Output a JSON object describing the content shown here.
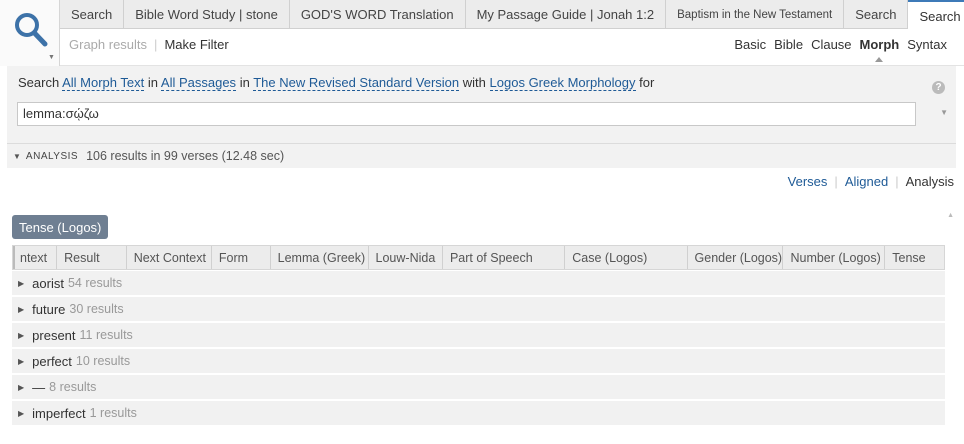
{
  "tabs": [
    {
      "label": "Search",
      "active": false,
      "small": false
    },
    {
      "label": "Bible Word Study | stone",
      "active": false,
      "small": false
    },
    {
      "label": "GOD'S WORD Translation",
      "active": false,
      "small": false
    },
    {
      "label": "My Passage Guide | Jonah 1:2",
      "active": false,
      "small": false
    },
    {
      "label": "Baptism in the New Testament",
      "active": false,
      "small": true
    },
    {
      "label": "Search",
      "active": false,
      "small": false
    },
    {
      "label": "Search",
      "active": true,
      "small": false
    }
  ],
  "tab_add_label": "+",
  "tab_close_label": "×",
  "toolbar": {
    "graph_results": "Graph results",
    "make_filter": "Make Filter",
    "modes": [
      "Basic",
      "Bible",
      "Clause",
      "Morph",
      "Syntax"
    ],
    "active_mode": "Morph"
  },
  "search": {
    "prefix": "Search",
    "scope": "All Morph Text",
    "in1": "in",
    "range": "All Passages",
    "in2": "in",
    "version": "The New Revised Standard Version",
    "with": "with",
    "morphology": "Logos Greek Morphology",
    "for": "for",
    "query": "lemma:σῴζω",
    "help": "?"
  },
  "results": {
    "section_label": "ANALYSIS",
    "summary": "106 results in 99 verses (12.48 sec)"
  },
  "view_links": {
    "verses": "Verses",
    "aligned": "Aligned",
    "analysis": "Analysis"
  },
  "group_by": "Tense (Logos)",
  "columns": [
    "ntext",
    "Result",
    "Next Context",
    "Form",
    "Lemma (Greek)",
    "Louw-Nida",
    "Part of Speech",
    "Case (Logos)",
    "Gender (Logos)",
    "Number (Logos)",
    "Tense"
  ],
  "groups": [
    {
      "name": "aorist",
      "count": "54 results"
    },
    {
      "name": "future",
      "count": "30 results"
    },
    {
      "name": "present",
      "count": "11 results"
    },
    {
      "name": "perfect",
      "count": "10 results"
    },
    {
      "name": "—",
      "count": "8 results"
    },
    {
      "name": "imperfect",
      "count": "1 results"
    }
  ],
  "colors": {
    "accent": "#3d7ab8",
    "link": "#1e5a96",
    "chip": "#6f7f92"
  }
}
